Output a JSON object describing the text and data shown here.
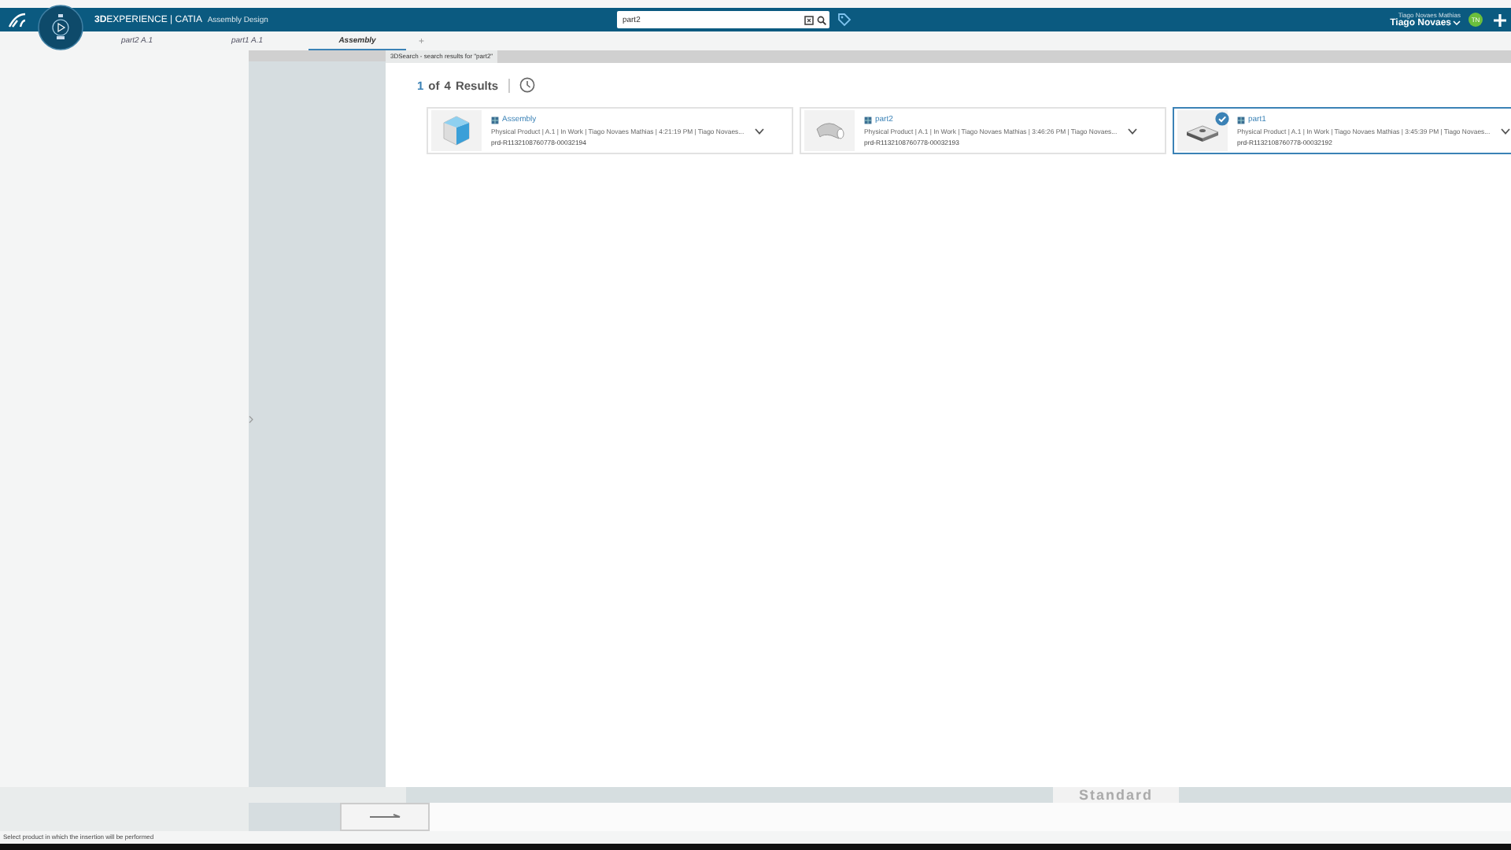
{
  "header": {
    "brand_bold": "3D",
    "brand": "EXPERIENCE | CATIA",
    "app": "Assembly Design",
    "search": {
      "value": "part2"
    },
    "user": {
      "full_name": "Tiago Novaes Mathias",
      "name": "Tiago Novaes",
      "initials": "TN"
    }
  },
  "side_panel": {
    "expanded": false
  },
  "tabs": [
    {
      "label": "part2 A.1",
      "selected": false
    },
    {
      "label": "part1 A.1",
      "selected": false
    },
    {
      "label": "Assembly",
      "selected": true
    }
  ],
  "add_tab": "+",
  "search_panel": {
    "tab": "3DSearch - search results for \"part2\"",
    "count_current": "1",
    "count_of": "of",
    "count_total": "4",
    "count_label": "Results",
    "results": [
      {
        "kind": "assembly",
        "title": "Assembly",
        "meta": "Physical Product | A.1 | In Work | Tiago Novaes Mathias | 4:21:19 PM | Tiago Novaes...",
        "id": "prd-R1132108760778-00032194",
        "selected": false
      },
      {
        "kind": "pipe",
        "title": "part2",
        "meta": "Physical Product | A.1 | In Work | Tiago Novaes Mathias | 3:46:26 PM | Tiago Novaes...",
        "id": "prd-R1132108760778-00032193",
        "selected": false
      },
      {
        "kind": "plate",
        "title": "part1",
        "meta": "Physical Product | A.1 | In Work | Tiago Novaes Mathias | 3:45:39 PM | Tiago Novaes...",
        "id": "prd-R1132108760778-00032192",
        "selected": true
      }
    ]
  },
  "toolbar": {
    "tab": "Standard"
  },
  "status_bar": "Select product in which the insertion will be performed"
}
